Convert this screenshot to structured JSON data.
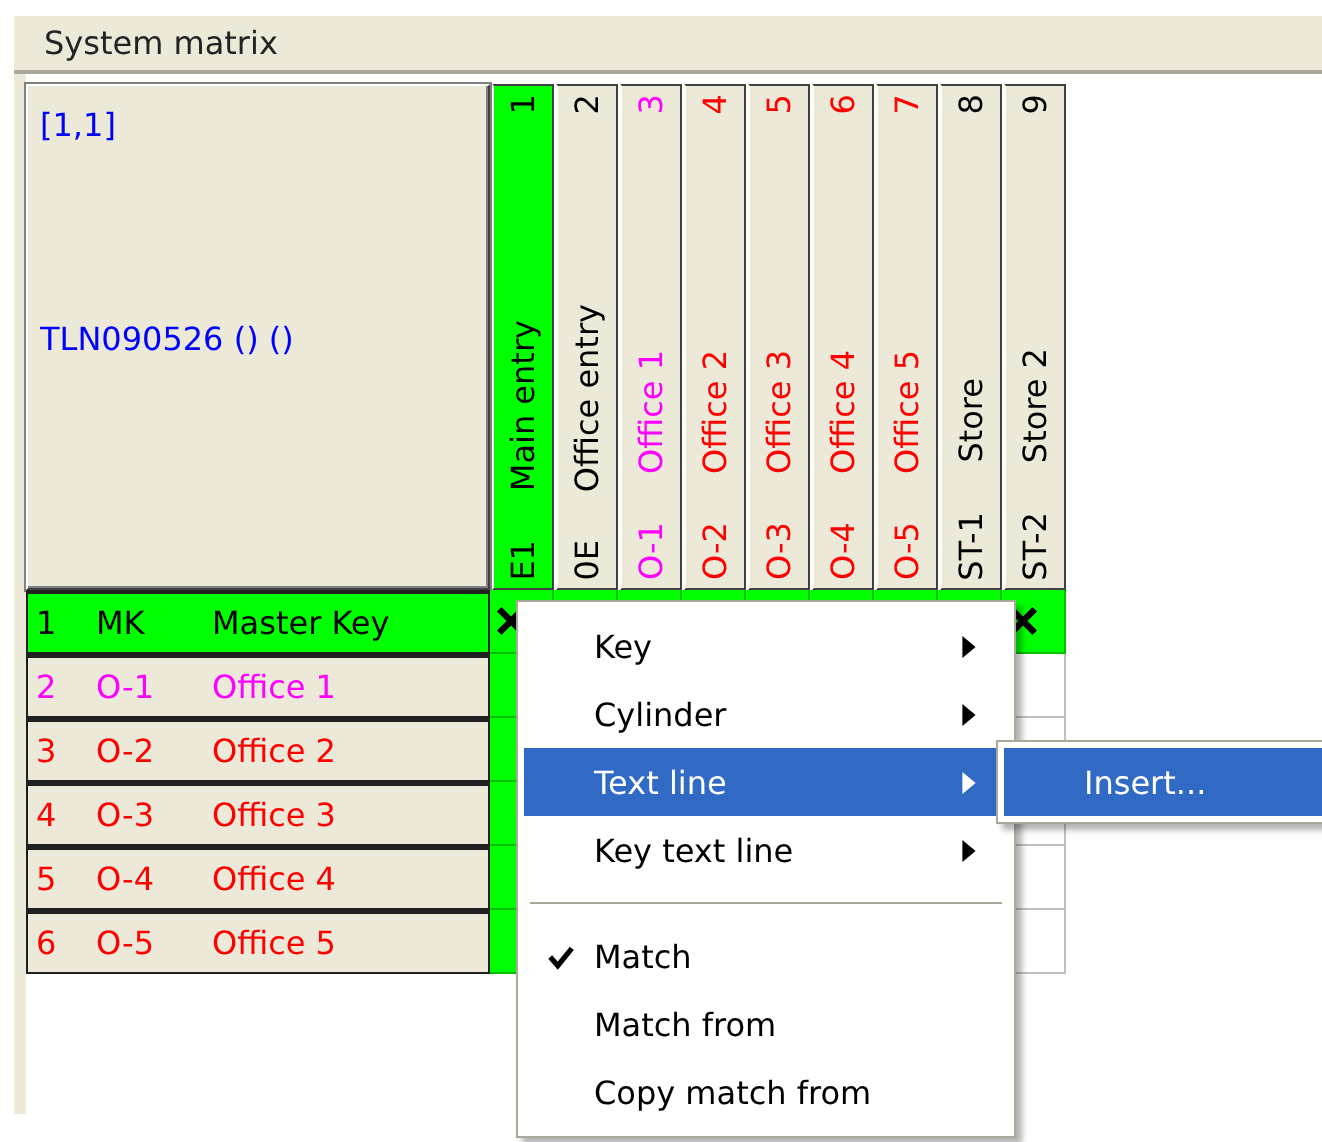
{
  "window": {
    "title": "System matrix"
  },
  "corner": {
    "position": "[1,1]",
    "system": "TLN090526 () ()"
  },
  "columns": [
    {
      "number": "1",
      "name": "Main entry",
      "code": "E1",
      "color": "#000000",
      "highlighted": true,
      "crossed_in_first_row": true
    },
    {
      "number": "2",
      "name": "Office entry",
      "code": "0E",
      "color": "#000000",
      "highlighted": false
    },
    {
      "number": "3",
      "name": "Office 1",
      "code": "O-1",
      "color": "#ff00ff",
      "highlighted": false
    },
    {
      "number": "4",
      "name": "Office 2",
      "code": "O-2",
      "color": "#ff0000",
      "highlighted": false
    },
    {
      "number": "5",
      "name": "Office 3",
      "code": "O-3",
      "color": "#ff0000",
      "highlighted": false
    },
    {
      "number": "6",
      "name": "Office 4",
      "code": "O-4",
      "color": "#ff0000",
      "highlighted": false
    },
    {
      "number": "7",
      "name": "Office 5",
      "code": "O-5",
      "color": "#ff0000",
      "highlighted": false
    },
    {
      "number": "8",
      "name": "Store",
      "code": "ST-1",
      "color": "#000000",
      "highlighted": false
    },
    {
      "number": "9",
      "name": "Store 2",
      "code": "ST-2",
      "color": "#000000",
      "highlighted": false,
      "crossed_in_first_row": true
    }
  ],
  "rows": [
    {
      "number": "1",
      "code": "MK",
      "name": "Master Key",
      "color": "#000000",
      "highlighted": true
    },
    {
      "number": "2",
      "code": "O-1",
      "name": "Office 1",
      "color": "#ff00ff",
      "highlighted": false
    },
    {
      "number": "3",
      "code": "O-2",
      "name": "Office 2",
      "color": "#ff0000",
      "highlighted": false
    },
    {
      "number": "4",
      "code": "O-3",
      "name": "Office 3",
      "color": "#ff0000",
      "highlighted": false
    },
    {
      "number": "5",
      "code": "O-4",
      "name": "Office 4",
      "color": "#ff0000",
      "highlighted": false
    },
    {
      "number": "6",
      "code": "O-5",
      "name": "Office 5",
      "color": "#ff0000",
      "highlighted": false
    }
  ],
  "context_menu": {
    "items": [
      {
        "kind": "item",
        "label": "Key",
        "submenu": true,
        "checked": false,
        "selected": false
      },
      {
        "kind": "item",
        "label": "Cylinder",
        "submenu": true,
        "checked": false,
        "selected": false
      },
      {
        "kind": "item",
        "label": "Text line",
        "submenu": true,
        "checked": false,
        "selected": true
      },
      {
        "kind": "item",
        "label": "Key text line",
        "submenu": true,
        "checked": false,
        "selected": false
      },
      {
        "kind": "separator"
      },
      {
        "kind": "item",
        "label": "Match",
        "submenu": false,
        "checked": true,
        "selected": false
      },
      {
        "kind": "item",
        "label": "Match from",
        "submenu": false,
        "checked": false,
        "selected": false
      },
      {
        "kind": "item",
        "label": "Copy match from",
        "submenu": false,
        "checked": false,
        "selected": false
      }
    ]
  },
  "submenu": {
    "items": [
      {
        "label": "Insert...",
        "selected": true
      }
    ]
  }
}
